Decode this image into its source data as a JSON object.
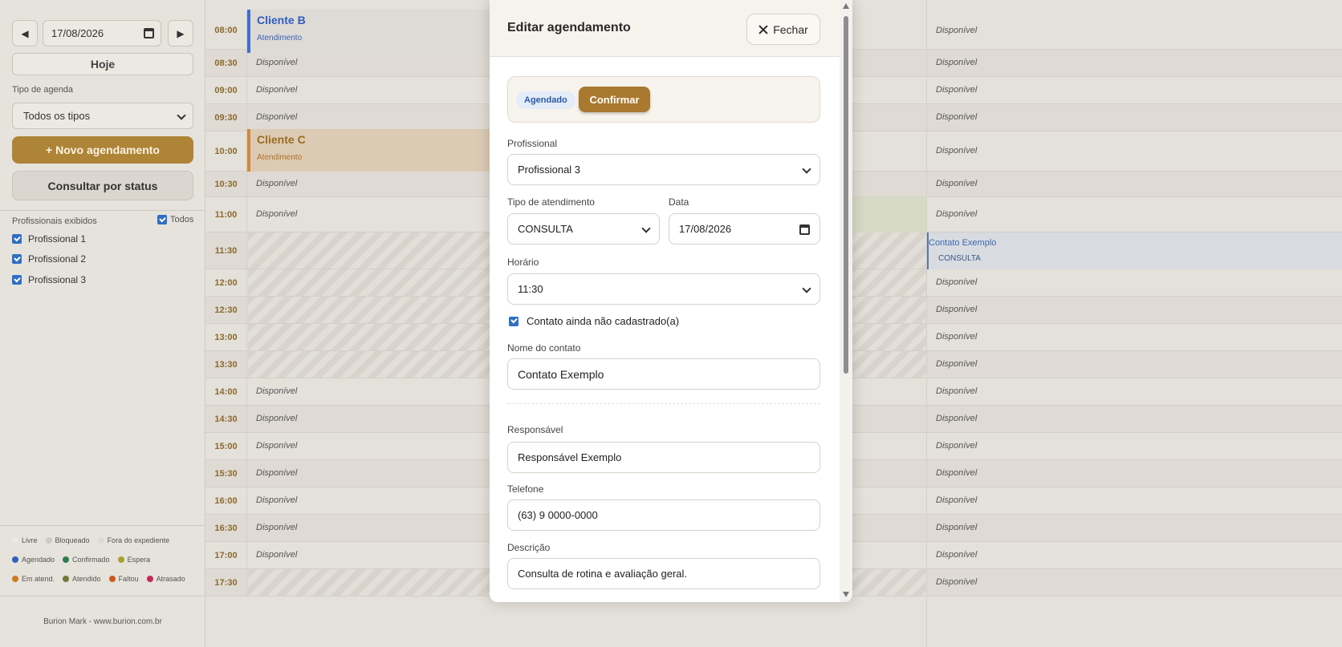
{
  "sidebar": {
    "date": "17/08/2026",
    "prev_label": "◀",
    "next_label": "▶",
    "today_label": "Hoje",
    "tipo_label": "Tipo de agenda",
    "tipo_value": "Todos os tipos",
    "novo_label": "+ Novo agendamento",
    "status_label": "Consultar por status",
    "profissionais_label": "Profissionais exibidos",
    "todos_label": "Todos",
    "profissionais": [
      "Profissional 1",
      "Profissional 2",
      "Profissional 3"
    ],
    "legend": [
      {
        "label": "Livre",
        "color": "#ece9e4"
      },
      {
        "label": "Bloqueado",
        "color": "#cfcac3"
      },
      {
        "label": "Fora do expediente",
        "color": "#dcd8d2"
      },
      {
        "label": "Agendado",
        "color": "#2f62b8"
      },
      {
        "label": "Confirmado",
        "color": "#2e7d4f"
      },
      {
        "label": "Espera",
        "color": "#a8a030"
      },
      {
        "label": "Em atend.",
        "color": "#d07a1c"
      },
      {
        "label": "Atendido",
        "color": "#6d7a3a"
      },
      {
        "label": "Faltou",
        "color": "#cc5a1a"
      },
      {
        "label": "Atrasado",
        "color": "#c22a55"
      }
    ],
    "footer": "Burion Mark - www.burion.com.br"
  },
  "schedule": {
    "available_label": "Disponível",
    "rows": [
      {
        "time": "08:00",
        "left": "",
        "right": "Disponível",
        "alt": false
      },
      {
        "time": "08:30",
        "left": "Disponível",
        "right": "Disponível",
        "alt": true
      },
      {
        "time": "09:00",
        "left": "Disponível",
        "right": "Disponível",
        "alt": false
      },
      {
        "time": "09:30",
        "left": "Disponível",
        "right": "Disponível",
        "alt": true
      },
      {
        "time": "10:00",
        "left": "",
        "right": "Disponível",
        "alt": false
      },
      {
        "time": "10:30",
        "left": "Disponível",
        "right": "Disponível",
        "alt": true
      },
      {
        "time": "11:00",
        "left": "Disponível",
        "right": "Disponível",
        "alt": false
      },
      {
        "time": "11:30",
        "left": "",
        "right": "",
        "alt": true
      },
      {
        "time": "12:00",
        "left": "",
        "right": "Disponível",
        "alt": false
      },
      {
        "time": "12:30",
        "left": "",
        "right": "Disponível",
        "alt": true
      },
      {
        "time": "13:00",
        "left": "",
        "right": "Disponível",
        "alt": false
      },
      {
        "time": "13:30",
        "left": "",
        "right": "Disponível",
        "alt": true
      },
      {
        "time": "14:00",
        "left": "Disponível",
        "right": "Disponível",
        "alt": false
      },
      {
        "time": "14:30",
        "left": "Disponível",
        "right": "Disponível",
        "alt": true
      },
      {
        "time": "15:00",
        "left": "Disponível",
        "right": "Disponível",
        "alt": false
      },
      {
        "time": "15:30",
        "left": "Disponível",
        "right": "Disponível",
        "alt": true
      },
      {
        "time": "16:00",
        "left": "Disponível",
        "right": "Disponível",
        "alt": false
      },
      {
        "time": "16:30",
        "left": "Disponível",
        "right": "Disponível",
        "alt": true
      },
      {
        "time": "17:00",
        "left": "Disponível",
        "right": "Disponível",
        "alt": false
      },
      {
        "time": "17:30",
        "left": "",
        "right": "Disponível",
        "alt": true
      }
    ],
    "appointments": {
      "cliente_b": {
        "title": "Cliente B",
        "sub": "Atendimento"
      },
      "cliente_c": {
        "title": "Cliente C",
        "sub": "Atendimento"
      },
      "contato": {
        "title": "Contato Exemplo",
        "sub": "CONSULTA"
      }
    }
  },
  "modal": {
    "title": "Editar agendamento",
    "close_label": "Fechar",
    "status_badge": "Agendado",
    "confirm_label": "Confirmar",
    "profissional_label": "Profissional",
    "profissional_value": "Profissional 3",
    "tipo_label": "Tipo de atendimento",
    "tipo_value": "CONSULTA",
    "data_label": "Data",
    "data_value": "17/08/2026",
    "horario_label": "Horário",
    "horario_value": "11:30",
    "contato_check_label": "Contato ainda não cadastrado(a)",
    "nome_label": "Nome do contato",
    "nome_value": "Contato Exemplo",
    "responsavel_label": "Responsável",
    "responsavel_value": "Responsável Exemplo",
    "telefone_label": "Telefone",
    "telefone_value": "(63) 9 0000-0000",
    "descricao_label": "Descrição",
    "descricao_value": "Consulta de rotina e avaliação geral."
  }
}
